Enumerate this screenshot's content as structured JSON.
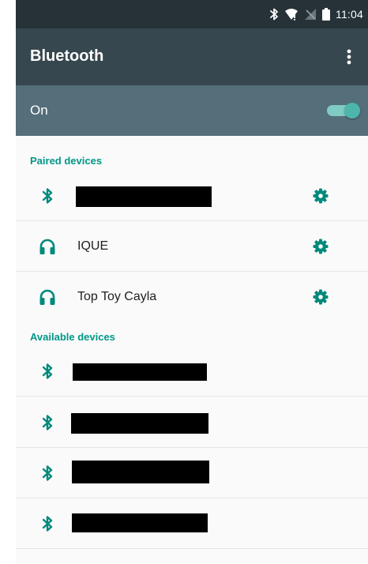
{
  "status_bar": {
    "time": "11:04",
    "icons": [
      "bluetooth-icon",
      "wifi-icon",
      "no-sim-icon",
      "battery-icon"
    ]
  },
  "app_bar": {
    "title": "Bluetooth",
    "menu_icon": "more-vert-icon"
  },
  "bluetooth_toggle": {
    "label": "On",
    "state": "on"
  },
  "paired_devices": {
    "header": "Paired devices",
    "items": [
      {
        "name": "",
        "icon": "bluetooth-icon",
        "redacted": true,
        "settings_icon": "gear-icon"
      },
      {
        "name": "IQUE",
        "icon": "headset-icon",
        "redacted": false,
        "settings_icon": "gear-icon"
      },
      {
        "name": "Top Toy Cayla",
        "icon": "headset-icon",
        "redacted": false,
        "settings_icon": "gear-icon"
      }
    ]
  },
  "available_devices": {
    "header": "Available devices",
    "items": [
      {
        "name": "",
        "icon": "bluetooth-icon",
        "redacted": true
      },
      {
        "name": "",
        "icon": "bluetooth-icon",
        "redacted": true
      },
      {
        "name": "",
        "icon": "bluetooth-icon",
        "redacted": true
      },
      {
        "name": "",
        "icon": "bluetooth-icon",
        "redacted": true
      }
    ]
  },
  "colors": {
    "status_bar": "#263238",
    "app_bar": "#37474f",
    "toggle_bar": "#546e7a",
    "accent": "#009688",
    "toggle_thumb": "#4db6ac"
  }
}
